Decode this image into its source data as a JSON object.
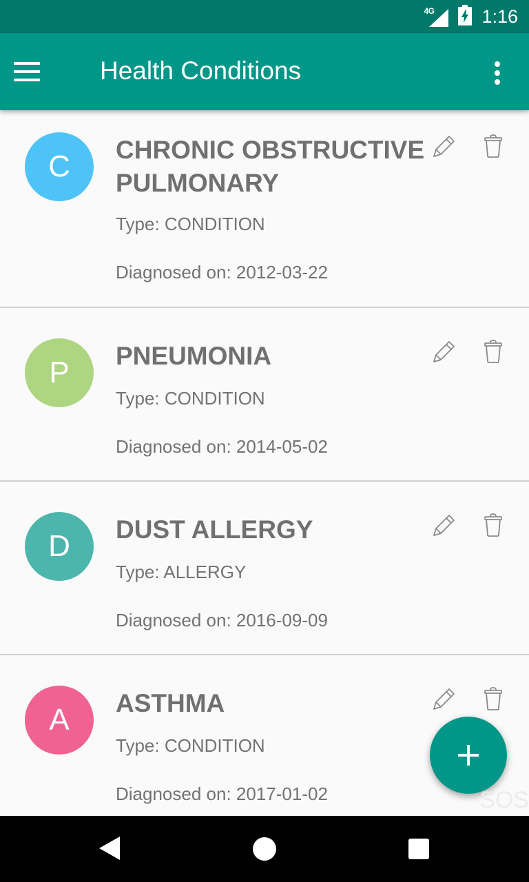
{
  "status_bar": {
    "network": "4G",
    "time": "1:16"
  },
  "app_bar": {
    "title": "Health Conditions"
  },
  "conditions": [
    {
      "initial": "C",
      "name": "CHRONIC OBSTRUCTIVE PULMONARY",
      "type": "Type: CONDITION",
      "diagnosed": "Diagnosed on: 2012-03-22",
      "color": "#4fc3f7"
    },
    {
      "initial": "P",
      "name": "PNEUMONIA",
      "type": "Type: CONDITION",
      "diagnosed": "Diagnosed on: 2014-05-02",
      "color": "#aed581"
    },
    {
      "initial": "D",
      "name": "DUST ALLERGY",
      "type": "Type: ALLERGY",
      "diagnosed": "Diagnosed on: 2016-09-09",
      "color": "#4db6ac"
    },
    {
      "initial": "A",
      "name": "ASTHMA",
      "type": "Type: CONDITION",
      "diagnosed": "Diagnosed on: 2017-01-02",
      "color": "#f06292"
    }
  ],
  "fab": {
    "icon": "plus-icon"
  },
  "sos_label": "SOS",
  "colors": {
    "primary": "#009688",
    "primary_dark": "#00796b"
  }
}
